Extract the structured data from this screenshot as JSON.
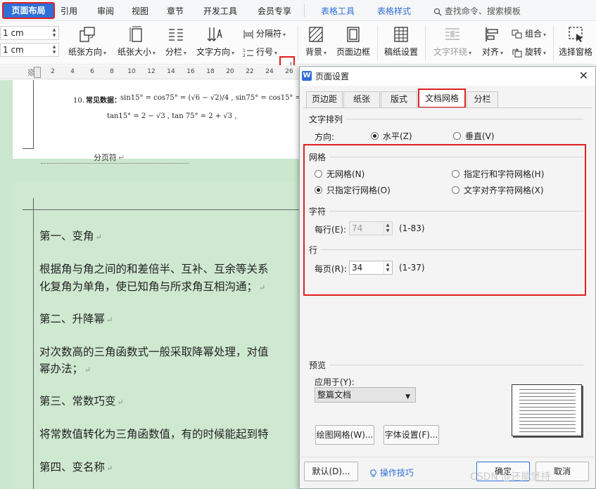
{
  "menu": {
    "active": "页面布局",
    "items": [
      "引用",
      "审阅",
      "视图",
      "章节",
      "开发工具",
      "会员专享"
    ],
    "table_tools": "表格工具",
    "table_style": "表格样式",
    "search_placeholder": "查找命令、搜索模板"
  },
  "ribbon": {
    "margin_top": "1 cm",
    "margin_bottom": "1 cm",
    "paper_orientation": "纸张方向",
    "paper_size": "纸张大小",
    "columns": "分栏",
    "text_direction": "文字方向",
    "separator": "分隔符",
    "line_number": "行号",
    "background": "背景",
    "page_border": "页面边框",
    "manuscript": "稿纸设置",
    "text_wrap": "文字环绕",
    "align": "对齐",
    "group": "组合",
    "rotate": "旋转",
    "selection_pane": "选择窗格"
  },
  "ruler": [
    "2",
    "4",
    "6",
    "8",
    "10",
    "12",
    "14",
    "16",
    "18",
    "20",
    "22",
    "24",
    "26"
  ],
  "document": {
    "formula_num": "10.",
    "formula_label": "常见数据：",
    "formula_line1": "sin15° = cos75° = (√6 − √2)/4 , sin75° = cos15° = (√6 + √2)/4 ,",
    "formula_line2": "tan15° = 2 − √3 ,  tan 75° = 2 + √3 ,",
    "page_break": "分页符",
    "lines": [
      "第一、变角",
      "根据角与角之间的和差倍半、互补、互余等关系",
      "化复角为单角，使已知角与所求角互相沟通；",
      "第二、升降幂",
      "对次数高的三角函数式一般采取降幂处理，对值",
      "幂办法；",
      "第三、常数巧变",
      "将常数值转化为三角函数值，有的时候能起到特",
      "第四、变名称"
    ]
  },
  "dialog": {
    "title": "页面设置",
    "tabs": [
      "页边距",
      "纸张",
      "版式",
      "文档网格",
      "分栏"
    ],
    "text_arrangement": {
      "label": "文字排列",
      "direction_label": "方向:",
      "horizontal": "水平(Z)",
      "vertical": "垂直(V)"
    },
    "grid": {
      "label": "网格",
      "no_grid": "无网格(N)",
      "line_char_grid": "指定行和字符网格(H)",
      "line_only_grid": "只指定行网格(O)",
      "align_char_grid": "文字对齐字符网格(X)"
    },
    "chars": {
      "label": "字符",
      "per_line_label": "每行(E):",
      "per_line_value": "74",
      "per_line_range": "(1-83)"
    },
    "lines": {
      "label": "行",
      "per_page_label": "每页(R):",
      "per_page_value": "34",
      "per_page_range": "(1-37)"
    },
    "preview": {
      "label": "预览",
      "apply_to_label": "应用于(Y):",
      "apply_to_value": "整篇文档"
    },
    "draw_grid": "绘图网格(W)...",
    "font_settings": "字体设置(F)...",
    "default": "默认(D)...",
    "tips": "操作技巧",
    "ok": "确定",
    "cancel": "取消"
  },
  "watermark": "CSDN @还能坚持",
  "colors": {
    "accent": "#2f6fd8",
    "highlight": "#e02020",
    "doc_bg": "#cbe7cd"
  }
}
